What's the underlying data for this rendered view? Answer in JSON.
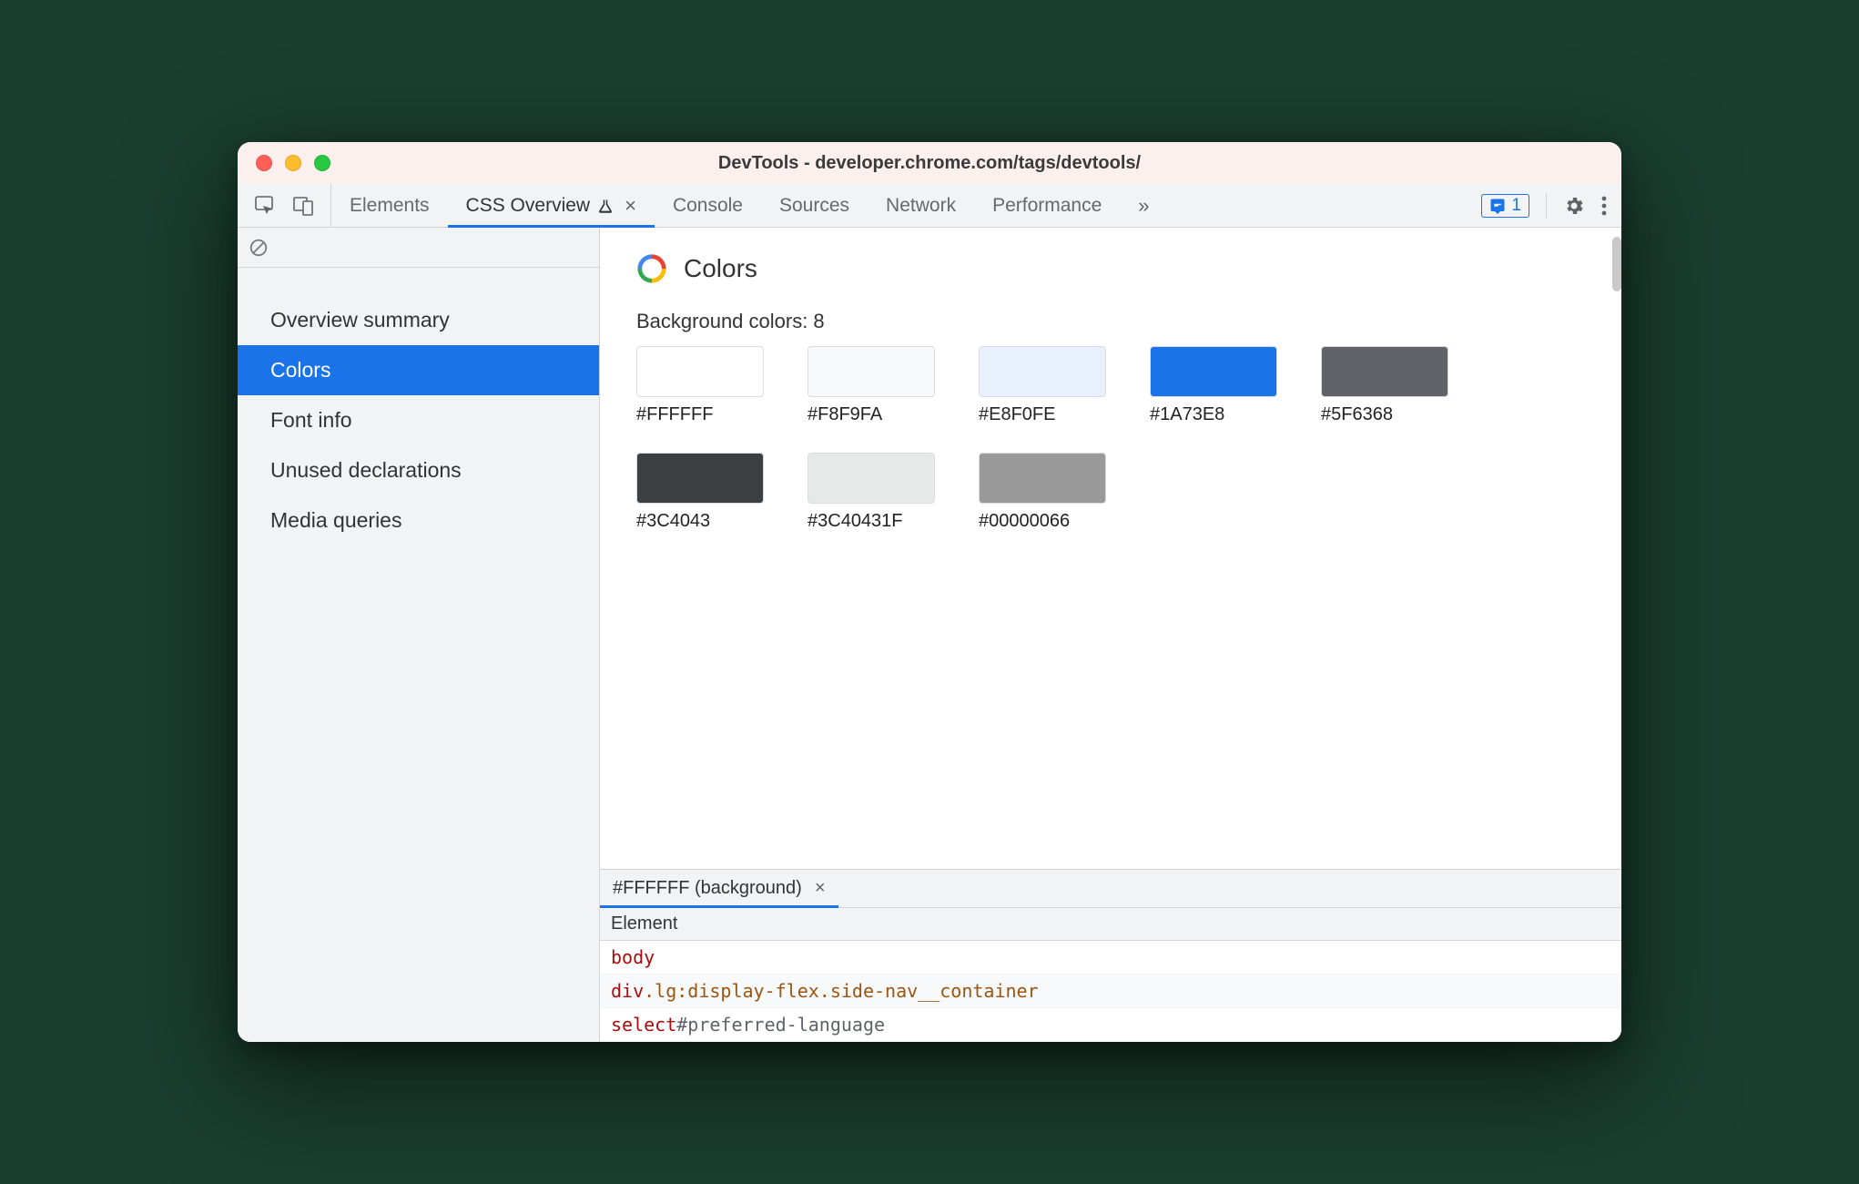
{
  "window": {
    "title": "DevTools - developer.chrome.com/tags/devtools/"
  },
  "tabs": {
    "elements": "Elements",
    "cssoverview": "CSS Overview",
    "console": "Console",
    "sources": "Sources",
    "network": "Network",
    "performance": "Performance"
  },
  "issues_count": "1",
  "sidebar": {
    "items": [
      "Overview summary",
      "Colors",
      "Font info",
      "Unused declarations",
      "Media queries"
    ],
    "active_index": 1
  },
  "section": {
    "title": "Colors",
    "bg_label": "Background colors: 8"
  },
  "swatches": [
    {
      "hex": "#FFFFFF",
      "css": "#FFFFFF"
    },
    {
      "hex": "#F8F9FA",
      "css": "#F8F9FA"
    },
    {
      "hex": "#E8F0FE",
      "css": "#E8F0FE"
    },
    {
      "hex": "#1A73E8",
      "css": "#1A73E8"
    },
    {
      "hex": "#5F6368",
      "css": "#5F6368"
    },
    {
      "hex": "#3C4043",
      "css": "#3C4043"
    },
    {
      "hex": "#3C40431F",
      "css": "rgba(60,64,67,0.12)"
    },
    {
      "hex": "#00000066",
      "css": "rgba(0,0,0,0.4)"
    }
  ],
  "detail": {
    "tab_label": "#FFFFFF (background)",
    "header": "Element",
    "rows": [
      [
        {
          "t": "tag",
          "v": "body"
        }
      ],
      [
        {
          "t": "tag",
          "v": "div"
        },
        {
          "t": "cls",
          "v": ".lg:display-flex.side-nav__container"
        }
      ],
      [
        {
          "t": "tag",
          "v": "select"
        },
        {
          "t": "idsel",
          "v": "#preferred-language"
        }
      ]
    ]
  }
}
